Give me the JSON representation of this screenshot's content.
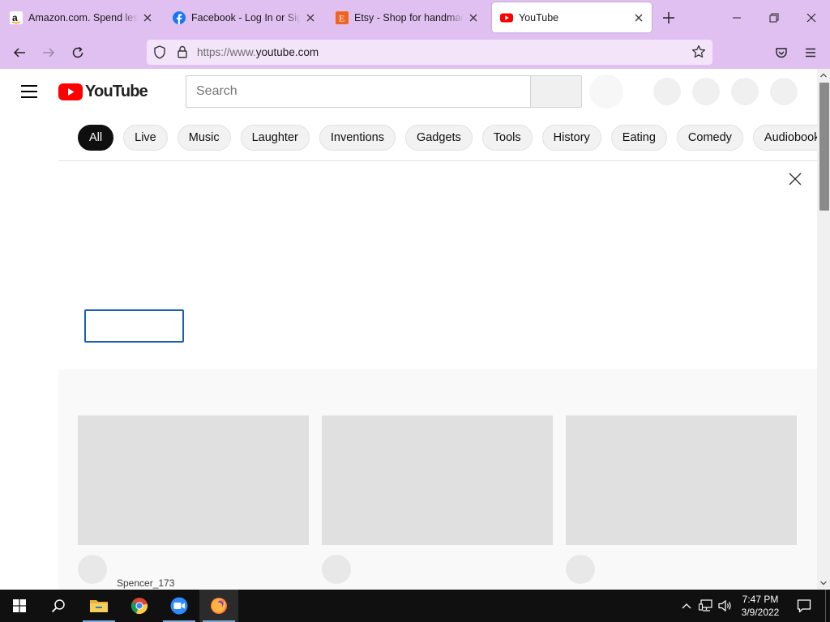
{
  "browser": {
    "tabs": [
      {
        "title": "Amazon.com. Spend less. Smile more.",
        "favicon": "amazon-icon",
        "active": false
      },
      {
        "title": "Facebook - Log In or Sign Up",
        "favicon": "facebook-icon",
        "active": false
      },
      {
        "title": "Etsy - Shop for handmade, vintage",
        "favicon": "etsy-icon",
        "active": false
      },
      {
        "title": "YouTube",
        "favicon": "youtube-icon",
        "active": true
      }
    ],
    "url_prefix": "https://www.",
    "url_domain": "youtube.com",
    "colors": {
      "chrome": "#e0c0f0",
      "urlbar": "#f3e4fa"
    }
  },
  "youtube": {
    "logo_text": "YouTube",
    "search_placeholder": "Search",
    "chips": [
      "All",
      "Live",
      "Music",
      "Laughter",
      "Inventions",
      "Gadgets",
      "Tools",
      "History",
      "Eating",
      "Comedy",
      "Audiobooks"
    ],
    "selected_chip": "All",
    "feed": {
      "channel_names": [
        "Spencer_173"
      ]
    },
    "colors": {
      "brand_red": "#ff0000",
      "chip_selected": "#0f0f0f",
      "focus_outline": "#1a5fb4"
    }
  },
  "taskbar": {
    "apps": [
      "file-explorer-icon",
      "chrome-icon",
      "zoom-icon",
      "firefox-icon"
    ],
    "time": "7:47 PM",
    "date": "3/9/2022"
  }
}
